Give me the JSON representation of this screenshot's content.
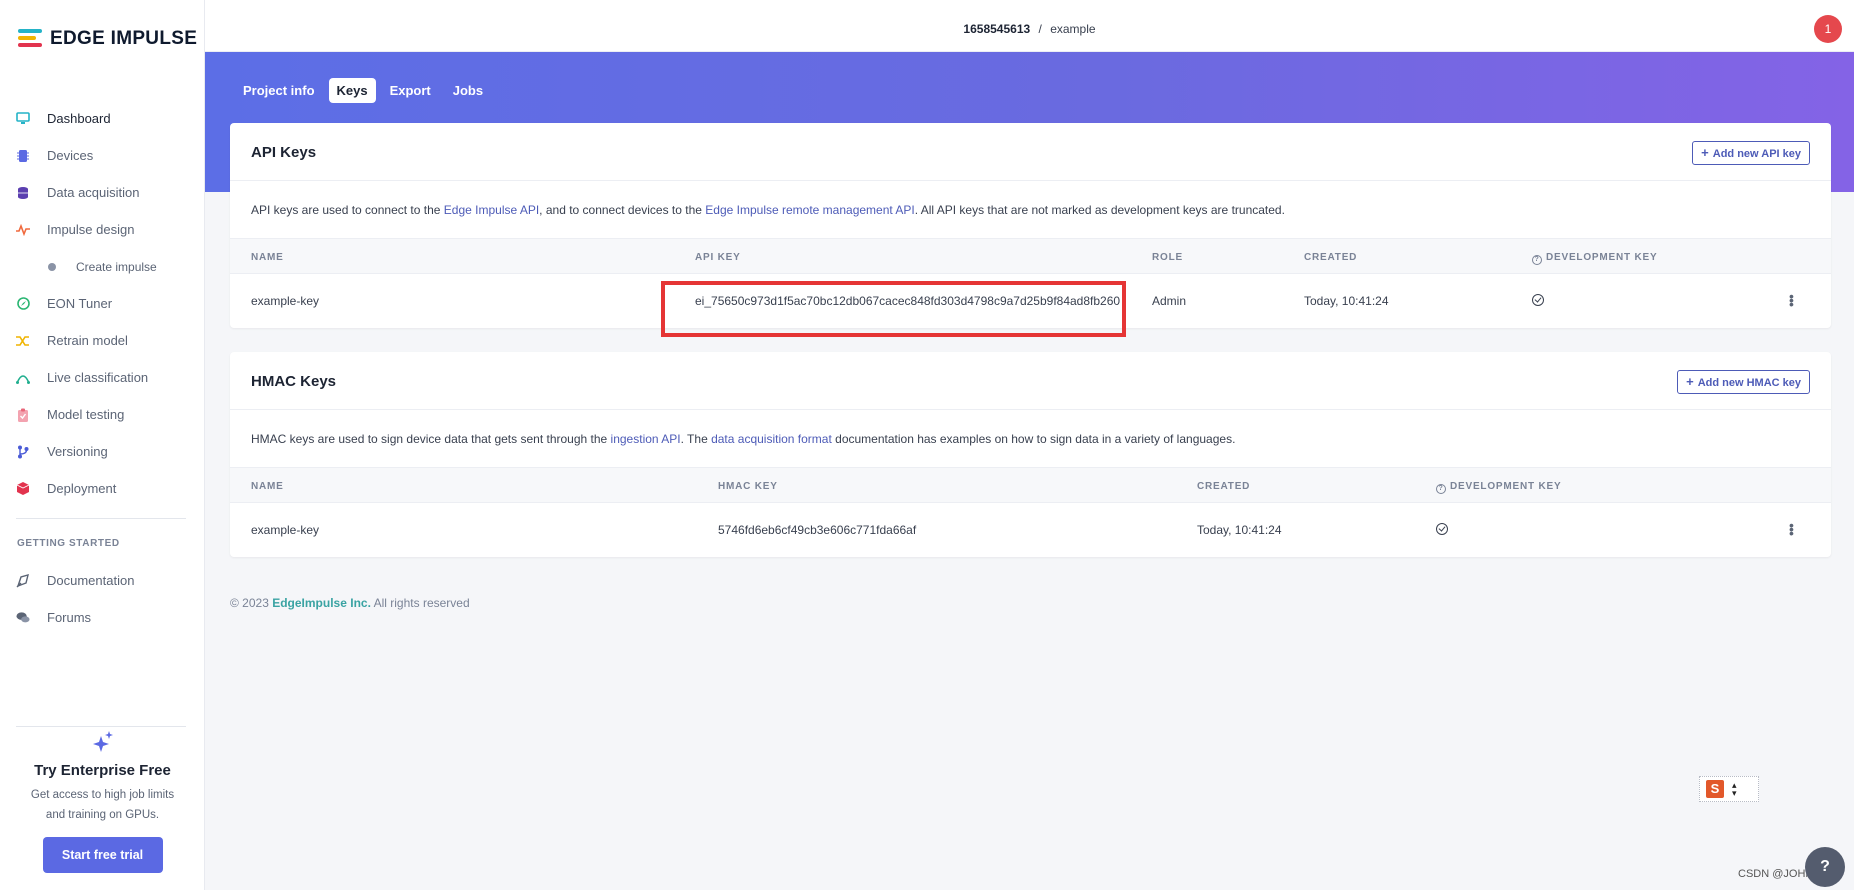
{
  "brand": {
    "name": "EDGE IMPULSE"
  },
  "header": {
    "project_id": "1658545613",
    "separator": "/",
    "project_name": "example",
    "notification_count": "1"
  },
  "sidebar": {
    "items": [
      {
        "label": "Dashboard",
        "icon": "monitor-icon",
        "color": "#24b3c7"
      },
      {
        "label": "Devices",
        "icon": "chip-icon",
        "color": "#5b69e3"
      },
      {
        "label": "Data acquisition",
        "icon": "database-icon",
        "color": "#5b3fb0"
      },
      {
        "label": "Impulse design",
        "icon": "pulse-icon",
        "color": "#f06a3e"
      }
    ],
    "sub_items": [
      {
        "label": "Create impulse"
      }
    ],
    "items2": [
      {
        "label": "EON Tuner",
        "icon": "compass-icon",
        "color": "#2bb673"
      },
      {
        "label": "Retrain model",
        "icon": "shuffle-icon",
        "color": "#f0b400"
      },
      {
        "label": "Live classification",
        "icon": "wave-icon",
        "color": "#1fae8e"
      },
      {
        "label": "Model testing",
        "icon": "clipboard-icon",
        "color": "#e8677a"
      },
      {
        "label": "Versioning",
        "icon": "branch-icon",
        "color": "#4a5bd6"
      },
      {
        "label": "Deployment",
        "icon": "cube-icon",
        "color": "#e2334e"
      }
    ],
    "getting_started_label": "GETTING STARTED",
    "getting_started": [
      {
        "label": "Documentation",
        "icon": "doc-icon"
      },
      {
        "label": "Forums",
        "icon": "chat-icon"
      }
    ],
    "promo": {
      "title": "Try Enterprise Free",
      "text_line1": "Get access to high job limits",
      "text_line2": "and training on GPUs.",
      "button": "Start free trial"
    }
  },
  "tabs": [
    "Project info",
    "Keys",
    "Export",
    "Jobs"
  ],
  "active_tab": "Keys",
  "api_keys": {
    "title": "API Keys",
    "add_button": "Add new API key",
    "desc_1": "API keys are used to connect to the ",
    "desc_link1": "Edge Impulse API",
    "desc_2": ", and to connect devices to the ",
    "desc_link2": "Edge Impulse remote management API",
    "desc_3": ". All API keys that are not marked as development keys are truncated.",
    "columns": [
      "NAME",
      "API KEY",
      "ROLE",
      "CREATED",
      "DEVELOPMENT KEY"
    ],
    "rows": [
      {
        "name": "example-key",
        "key": "ei_75650c973d1f5ac70bc12db067cacec848fd303d4798c9a7d25b9f84ad8fb260",
        "role": "Admin",
        "created": "Today, 10:41:24",
        "dev_key": true
      }
    ]
  },
  "hmac_keys": {
    "title": "HMAC Keys",
    "add_button": "Add new HMAC key",
    "desc_1": "HMAC keys are used to sign device data that gets sent through the ",
    "desc_link1": "ingestion API",
    "desc_2": ". The ",
    "desc_link2": "data acquisition format",
    "desc_3": " documentation has examples on how to sign data in a variety of languages.",
    "columns": [
      "NAME",
      "HMAC KEY",
      "CREATED",
      "DEVELOPMENT KEY"
    ],
    "rows": [
      {
        "name": "example-key",
        "key": "5746fd6eb6cf49cb3e606c771fda66af",
        "created": "Today, 10:41:24",
        "dev_key": true
      }
    ]
  },
  "footer": {
    "copyright": "© 2023 ",
    "company": "EdgeImpulse Inc.",
    "rights": " All rights reserved"
  },
  "overlay": {
    "ime_letter": "S",
    "watermark": "CSDN @JOHMCU",
    "help": "?"
  }
}
